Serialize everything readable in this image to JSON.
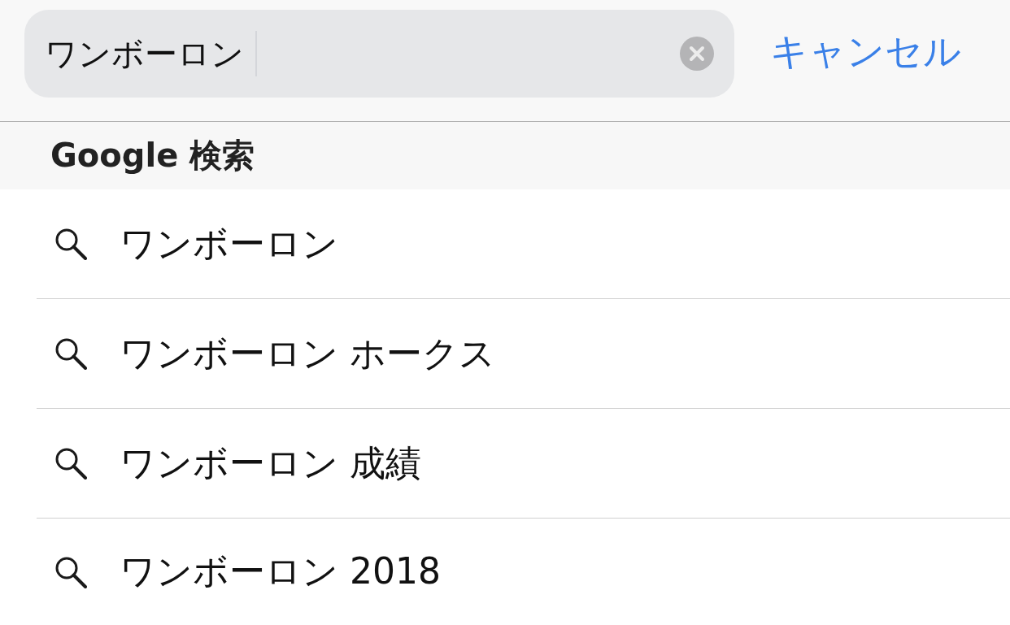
{
  "search_bar": {
    "value": "ワンボーロン",
    "focused": true,
    "cancel": "キャンセル"
  },
  "section": {
    "title": "Google 検索"
  },
  "suggestions": [
    {
      "text": "ワンボーロン"
    },
    {
      "text": "ワンボーロン ホークス"
    },
    {
      "text": "ワンボーロン 成績"
    },
    {
      "text": "ワンボーロン 2018"
    }
  ]
}
